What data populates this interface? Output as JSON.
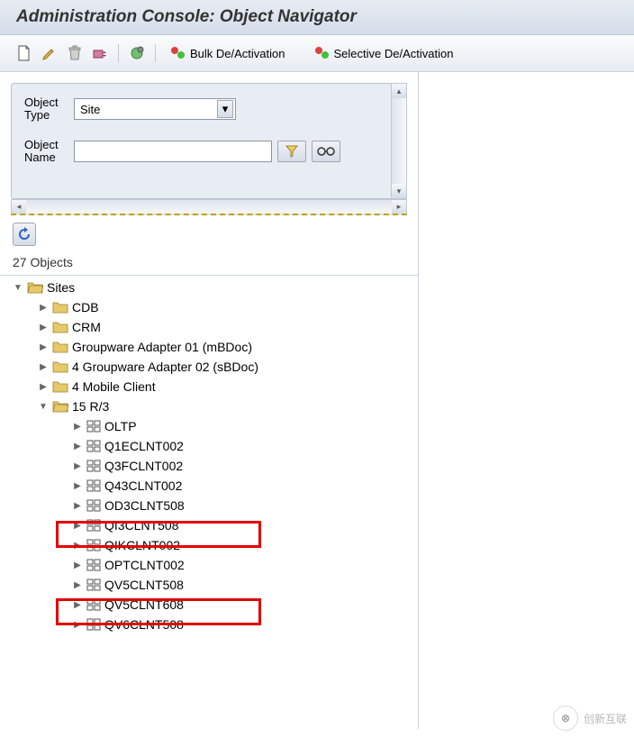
{
  "header": {
    "title": "Administration Console: Object Navigator"
  },
  "toolbar": {
    "bulk_label": "Bulk De/Activation",
    "selective_label": "Selective De/Activation"
  },
  "filter": {
    "object_type_label": "Object Type",
    "object_type_value": "Site",
    "object_name_label": "Object Name",
    "object_name_value": ""
  },
  "object_count": "27 Objects",
  "tree": {
    "root": "Sites",
    "children": [
      {
        "label": "CDB",
        "type": "folder"
      },
      {
        "label": "CRM",
        "type": "folder"
      },
      {
        "label": "Groupware Adapter 01 (mBDoc)",
        "type": "folder"
      },
      {
        "label": "4 Groupware Adapter 02 (sBDoc)",
        "type": "folder"
      },
      {
        "label": "4 Mobile Client",
        "type": "folder"
      },
      {
        "label": "15 R/3",
        "type": "folder",
        "expanded": true,
        "children": [
          {
            "label": "OLTP"
          },
          {
            "label": "Q1ECLNT002"
          },
          {
            "label": "Q3FCLNT002"
          },
          {
            "label": "Q43CLNT002"
          },
          {
            "label": "OD3CLNT508"
          },
          {
            "label": "QI3CLNT508",
            "highlighted": true
          },
          {
            "label": "QIKCLNT002"
          },
          {
            "label": "OPTCLNT002"
          },
          {
            "label": "QV5CLNT508",
            "highlighted": true
          },
          {
            "label": "QV5CLNT608"
          },
          {
            "label": "QV6CLNT508"
          }
        ]
      }
    ]
  },
  "watermark": {
    "text": "创新互联"
  }
}
